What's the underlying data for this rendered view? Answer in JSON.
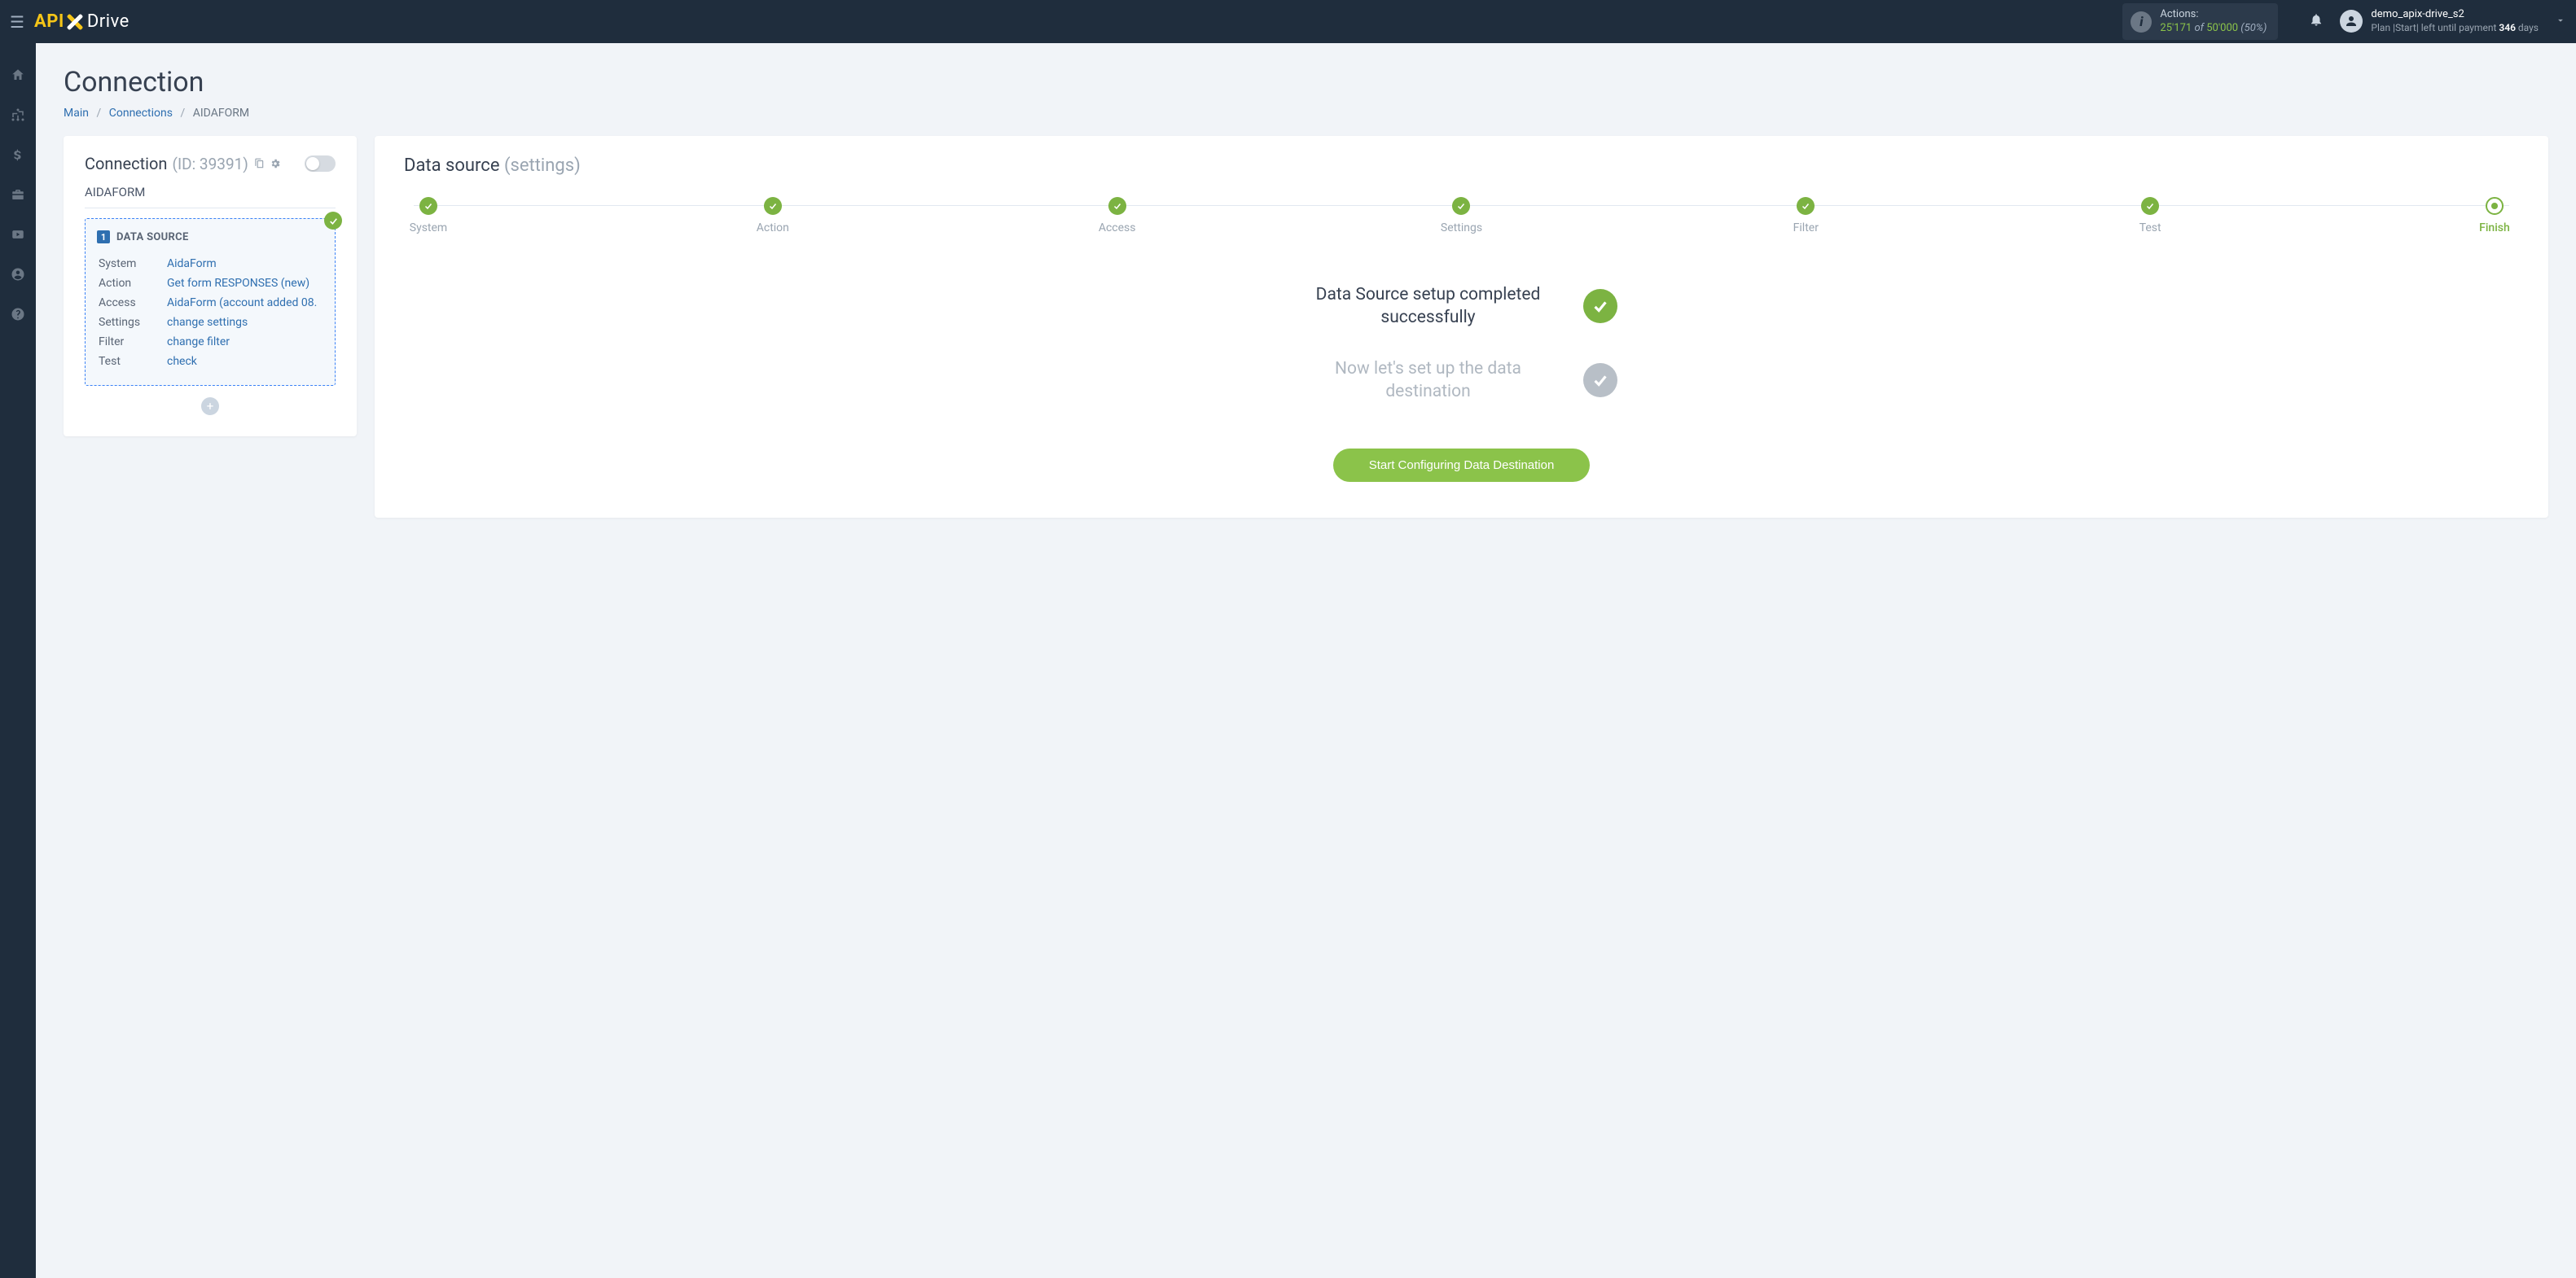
{
  "header": {
    "logo": {
      "api": "API",
      "drive": "Drive"
    },
    "actions": {
      "label": "Actions:",
      "used": "25'171",
      "of": "of",
      "total": "50'000",
      "pct": "(50%)"
    },
    "user": {
      "name": "demo_apix-drive_s2",
      "plan_prefix": "Plan |Start| left until payment ",
      "days": "346",
      "days_suffix": " days"
    }
  },
  "page": {
    "title": "Connection",
    "breadcrumb": {
      "main": "Main",
      "connections": "Connections",
      "current": "AIDAFORM"
    }
  },
  "connection_card": {
    "heading": "Connection",
    "id_label": "(ID: 39391)",
    "name": "AIDAFORM",
    "ds_block_title": "DATA SOURCE",
    "ds_number": "1",
    "rows": [
      {
        "label": "System",
        "value": "AidaForm"
      },
      {
        "label": "Action",
        "value": "Get form RESPONSES (new)"
      },
      {
        "label": "Access",
        "value": "AidaForm (account added 08."
      },
      {
        "label": "Settings",
        "value": "change settings"
      },
      {
        "label": "Filter",
        "value": "change filter"
      },
      {
        "label": "Test",
        "value": "check"
      }
    ]
  },
  "source_card": {
    "heading": "Data source",
    "heading_sub": "(settings)",
    "steps": [
      "System",
      "Action",
      "Access",
      "Settings",
      "Filter",
      "Test",
      "Finish"
    ],
    "status_done": "Data Source setup completed successfully",
    "status_pending": "Now let's set up the data destination",
    "cta": "Start Configuring Data Destination"
  }
}
